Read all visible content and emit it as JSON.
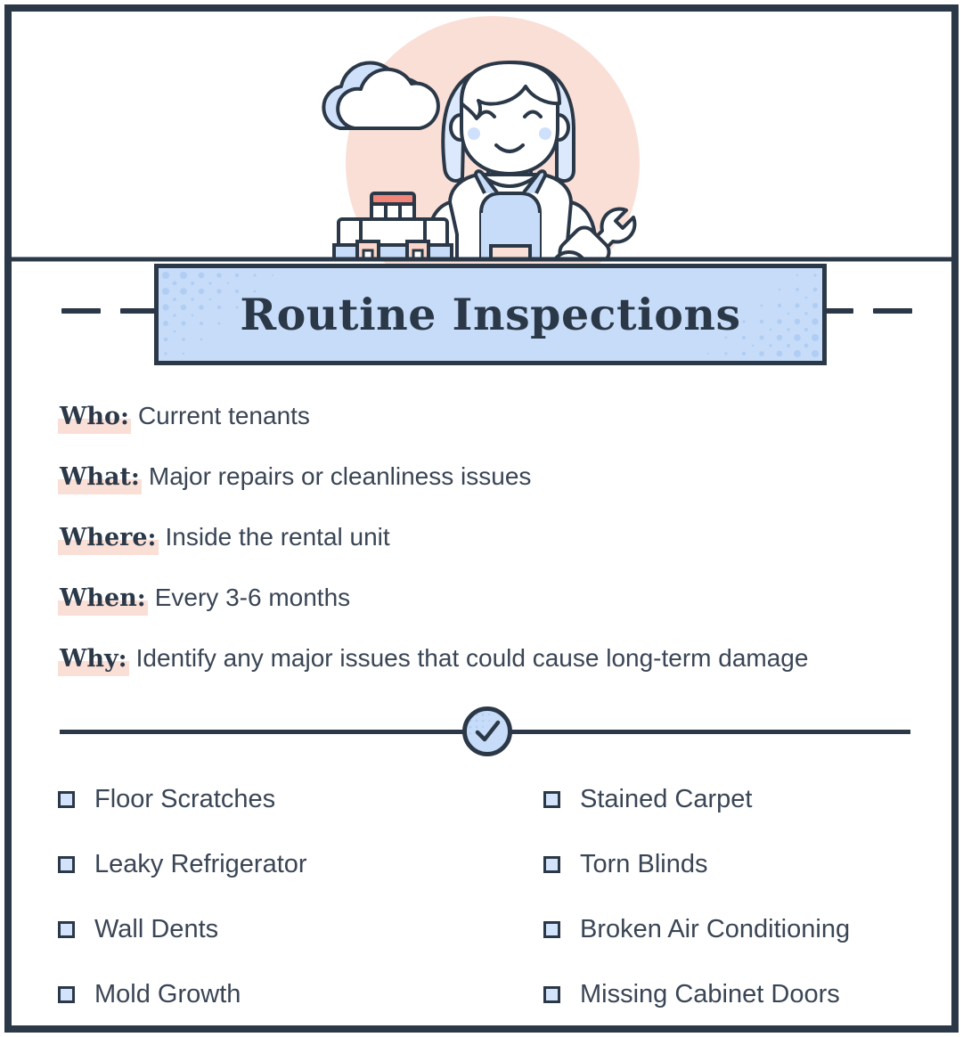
{
  "banner": {
    "title": "Routine Inspections"
  },
  "facts": [
    {
      "label": "Who:",
      "value": "Current tenants"
    },
    {
      "label": "What:",
      "value": "Major repairs or cleanliness issues"
    },
    {
      "label": "Where:",
      "value": "Inside the rental unit"
    },
    {
      "label": "When:",
      "value": "Every 3-6 months"
    },
    {
      "label": "Why:",
      "value": "Identify any major issues that could cause long-term damage"
    }
  ],
  "divider": {
    "icon": "check-circle-icon"
  },
  "checklist": {
    "left_column": [
      "Floor Scratches",
      "Leaky Refrigerator",
      "Wall Dents",
      "Mold Growth"
    ],
    "right_column": [
      "Stained Carpet",
      "Torn Blinds",
      "Broken Air Conditioning",
      "Missing Cabinet Doors"
    ]
  },
  "illustration": {
    "name": "maintenance-worker-illustration",
    "elements": [
      "cloud-icon",
      "pink-circle-backdrop",
      "worker-character",
      "toolbox-icon",
      "wrench-icon",
      "counter-surface"
    ]
  },
  "colors": {
    "frame": "#2b3848",
    "banner_fill": "#c7dcf8",
    "highlight": "#fadfd7",
    "text": "#3a4555",
    "checkbox_fill": "#d3e3fb",
    "circle_backdrop": "#fadfd7",
    "accent_coral": "#f2857a"
  }
}
